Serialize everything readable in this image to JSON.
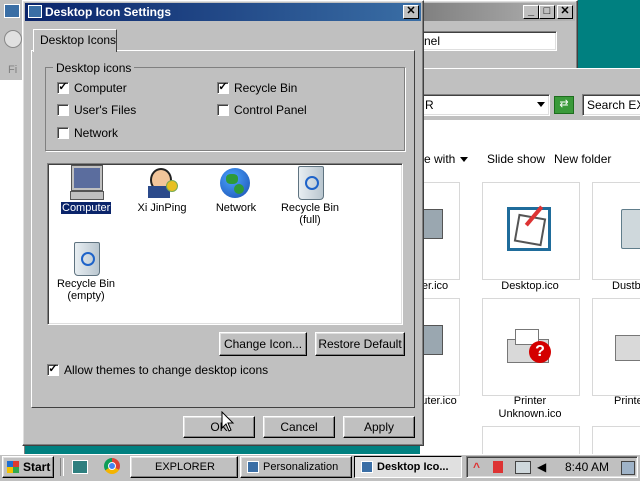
{
  "background_window": {
    "address_fragment": "nel",
    "left_edge_text": "Fi"
  },
  "explorer_window": {
    "address": "R",
    "search_placeholder": "Search EXP",
    "toolbar": {
      "share_with": "e with",
      "slide_show": "Slide show",
      "new_folder": "New folder"
    },
    "files": [
      {
        "label": "er.ico",
        "icon": "computer-icon"
      },
      {
        "label": "Desktop.ico",
        "icon": "desktop-icon"
      },
      {
        "label": "Dustb",
        "icon": "recycle-bin-icon"
      },
      {
        "label": "uter.ico",
        "icon": "computer-icon"
      },
      {
        "label": "Printer\nUnknown.ico",
        "icon": "printer-unknown-icon"
      },
      {
        "label": "Printe",
        "icon": "printer-icon"
      }
    ]
  },
  "dialog": {
    "title": "Desktop Icon Settings",
    "tab": "Desktop Icons",
    "group_title": "Desktop icons",
    "checkboxes": [
      {
        "label": "Computer",
        "checked": true
      },
      {
        "label": "Recycle Bin",
        "checked": true
      },
      {
        "label": "User's Files",
        "checked": false
      },
      {
        "label": "Control Panel",
        "checked": false
      },
      {
        "label": "Network",
        "checked": false
      }
    ],
    "icons": [
      {
        "label": "Computer",
        "selected": true
      },
      {
        "label": "Xi JinPing",
        "selected": false
      },
      {
        "label": "Network",
        "selected": false
      },
      {
        "label": "Recycle Bin\n(full)",
        "selected": false
      },
      {
        "label": "Recycle Bin\n(empty)",
        "selected": false
      }
    ],
    "change_icon_button": "Change Icon...",
    "restore_default_button": "Restore Default",
    "allow_themes_label": "Allow themes to change desktop icons",
    "allow_themes_checked": true,
    "ok_button": "OK",
    "cancel_button": "Cancel",
    "apply_button": "Apply"
  },
  "taskbar": {
    "start_label": "Start",
    "tasks": [
      {
        "label": "EXPLORER",
        "active": false
      },
      {
        "label": "Personalization",
        "active": false
      },
      {
        "label": "Desktop Ico...",
        "active": true
      }
    ],
    "clock": "8:40 AM"
  },
  "colors": {
    "desktop": "#008080",
    "title_active": "#0a246a",
    "face": "#c0c0c0",
    "selection": "#0a246a"
  }
}
